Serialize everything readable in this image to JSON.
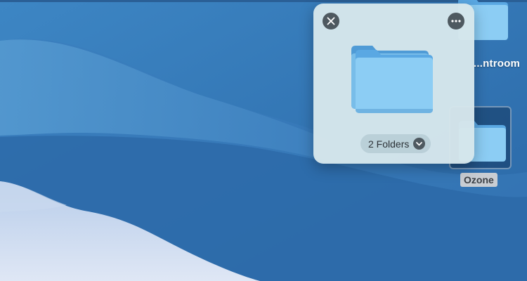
{
  "desktop": {
    "icons": [
      {
        "label": "...ntroom",
        "selected": false,
        "icon": "folder-icon"
      },
      {
        "label": "Ozone",
        "selected": true,
        "icon": "folder-icon"
      }
    ]
  },
  "preview": {
    "close_icon": "close-icon",
    "more_icon": "more-options-icon",
    "stack_icon": "folder-stack-icon",
    "summary_label": "2 Folders",
    "summary_icon": "chevron-down-icon"
  },
  "colors": {
    "wallpaper": "#2f6fae",
    "folder": "#8ccdf4",
    "panel": "#d6e6eb",
    "button": "#4e5960"
  }
}
